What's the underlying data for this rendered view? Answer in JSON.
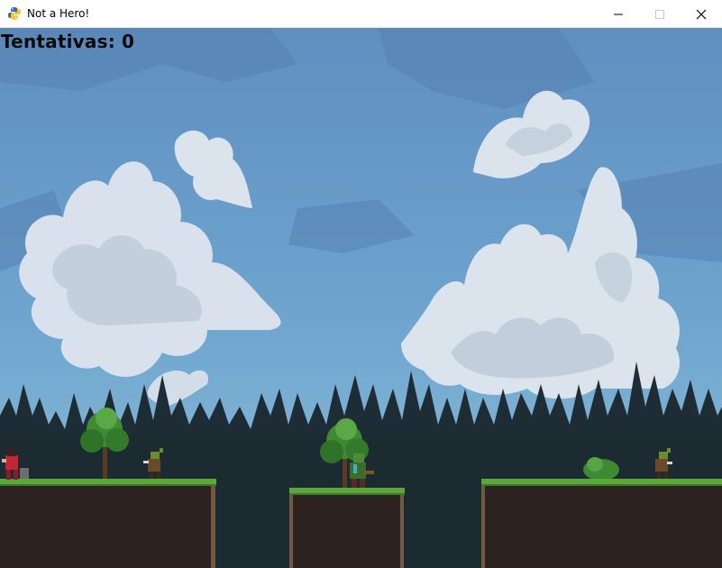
{
  "window": {
    "title": "Not a Hero!",
    "icon": "python-icon",
    "controls": [
      "minimize-icon",
      "maximize-icon",
      "close-icon"
    ]
  },
  "hud": {
    "attempts_label": "Tentativas: 0"
  },
  "scene": {
    "background": "sky-with-clouds-and-pine-forest",
    "platforms": 3,
    "characters": [
      "player-knight",
      "goblin-dagger-left",
      "orc-brute-middle",
      "goblin-dagger-right"
    ],
    "colors": {
      "sky": "#6c9fcb",
      "cloud": "#dfe6ee",
      "forest": "#1f2e36",
      "grass": "#5aa83c",
      "dirt": "#2c2220",
      "pit": "#1b2a30"
    }
  }
}
